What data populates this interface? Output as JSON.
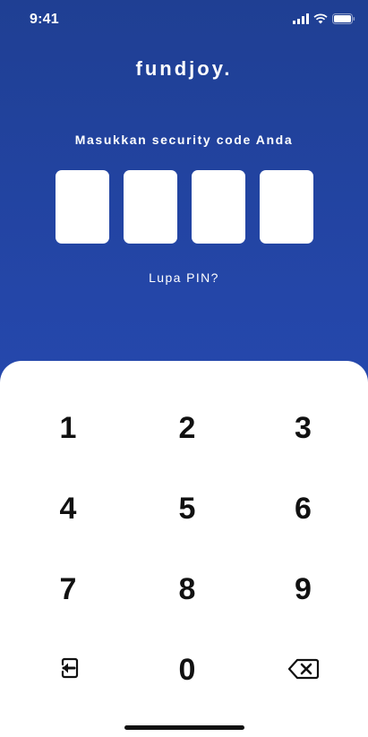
{
  "status_bar": {
    "time": "9:41",
    "icons": [
      "cellular-signal-icon",
      "wifi-icon",
      "battery-icon"
    ]
  },
  "app": {
    "brand": "fundjoy.",
    "prompt": "Masukkan security code Anda",
    "pin_length": 4,
    "pin_entered": 0,
    "forgot_link": "Lupa PIN?"
  },
  "keypad": {
    "rows": [
      [
        "1",
        "2",
        "3"
      ],
      [
        "4",
        "5",
        "6"
      ],
      [
        "7",
        "8",
        "9"
      ]
    ],
    "bottom_left_icon": "logout-icon",
    "bottom_center": "0",
    "bottom_right_icon": "backspace-icon"
  },
  "colors": {
    "background_top": "#1f3f93",
    "background_bottom": "#2a4fbd",
    "text_on_blue": "#ffffff",
    "key_text": "#111111"
  }
}
